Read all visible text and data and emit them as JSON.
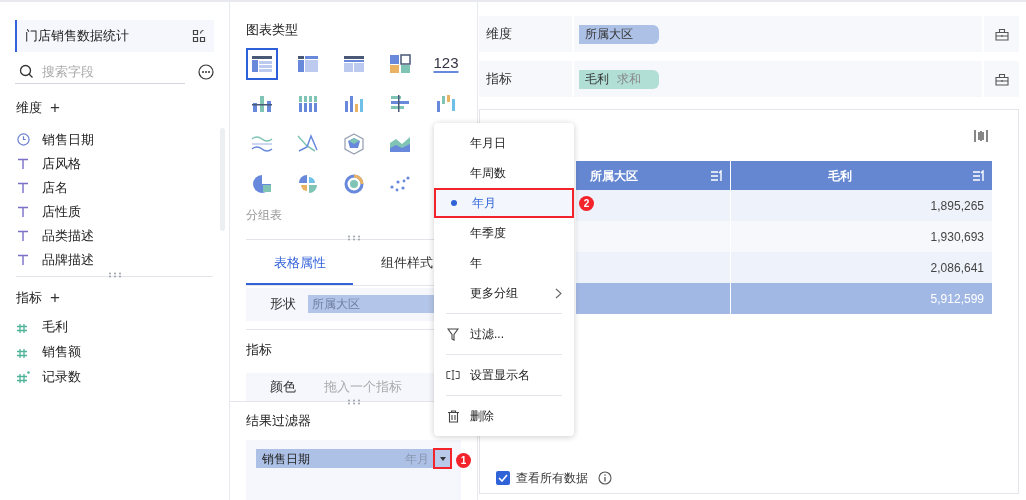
{
  "left_panel": {
    "dataset": "门店销售数据统计",
    "search": {
      "placeholder": "搜索字段"
    },
    "dimensions": {
      "title": "维度",
      "add": "+",
      "items": [
        {
          "kind": "date",
          "label": "销售日期"
        },
        {
          "kind": "text",
          "label": "店风格"
        },
        {
          "kind": "text",
          "label": "店名"
        },
        {
          "kind": "text",
          "label": "店性质"
        },
        {
          "kind": "text",
          "label": "品类描述"
        },
        {
          "kind": "text",
          "label": "品牌描述"
        }
      ]
    },
    "measures": {
      "title": "指标",
      "add": "+",
      "items": [
        {
          "kind": "number",
          "label": "毛利"
        },
        {
          "kind": "number",
          "label": "销售额"
        },
        {
          "kind": "count",
          "label": "记录数"
        }
      ]
    }
  },
  "middle_panel": {
    "chart_types_title": "图表类型",
    "chart_type_rows": [
      [
        {
          "kind": "group-table",
          "selected": true
        },
        {
          "kind": "cross-table",
          "selected": false
        },
        {
          "kind": "detail-table",
          "selected": false
        },
        {
          "kind": "color-table",
          "selected": false
        },
        {
          "kind": "number",
          "text": "123",
          "selected": false
        }
      ],
      [
        {
          "kind": "bar-stack",
          "selected": false
        },
        {
          "kind": "bar-grid",
          "selected": false
        },
        {
          "kind": "bar",
          "selected": false
        },
        {
          "kind": "hbar",
          "selected": false
        },
        {
          "kind": "range-bar",
          "selected": false
        }
      ],
      [
        {
          "kind": "wave",
          "selected": false
        },
        {
          "kind": "line-cross",
          "selected": false
        },
        {
          "kind": "radar",
          "selected": false
        },
        {
          "kind": "area",
          "selected": false
        }
      ],
      [
        {
          "kind": "pie",
          "selected": false
        },
        {
          "kind": "rose",
          "selected": false
        },
        {
          "kind": "ring",
          "selected": false
        },
        {
          "kind": "scatter",
          "selected": false
        }
      ]
    ],
    "chart_type_name": "分组表",
    "tabs": [
      {
        "label": "表格属性",
        "selected": true
      },
      {
        "label": "组件样式",
        "selected": false
      }
    ],
    "shape": {
      "label": "形状",
      "value": "所属大区"
    },
    "measure_title": "指标",
    "color": {
      "label": "颜色",
      "placeholder": "拖入一个指标"
    },
    "filter_title": "结果过滤器",
    "filter_chip": {
      "label": "销售日期",
      "grouping": "年月"
    }
  },
  "right_panel": {
    "dimension": {
      "label": "维度",
      "chip": "所属大区"
    },
    "measure": {
      "label": "指标",
      "chip": "毛利",
      "aggregation": "求和"
    },
    "table": {
      "columns": [
        "所属大区",
        "毛利"
      ],
      "rows": [
        [
          "1,895,265"
        ],
        [
          "1,930,693"
        ],
        [
          "2,086,641"
        ]
      ],
      "total": "5,912,599"
    },
    "show_all": {
      "label": "查看所有数据",
      "checked": true
    }
  },
  "menu": {
    "groupings": [
      {
        "label": "年月日",
        "selected": false
      },
      {
        "label": "年周数",
        "selected": false
      },
      {
        "label": "年月",
        "selected": true
      },
      {
        "label": "年季度",
        "selected": false
      },
      {
        "label": "年",
        "selected": false
      },
      {
        "label": "更多分组",
        "submenu": true,
        "selected": false
      }
    ],
    "actions": [
      {
        "kind": "filter",
        "label": "过滤..."
      },
      {
        "kind": "rename",
        "label": "设置显示名"
      },
      {
        "kind": "delete",
        "label": "删除"
      }
    ]
  },
  "annotations": [
    "1",
    "2"
  ]
}
